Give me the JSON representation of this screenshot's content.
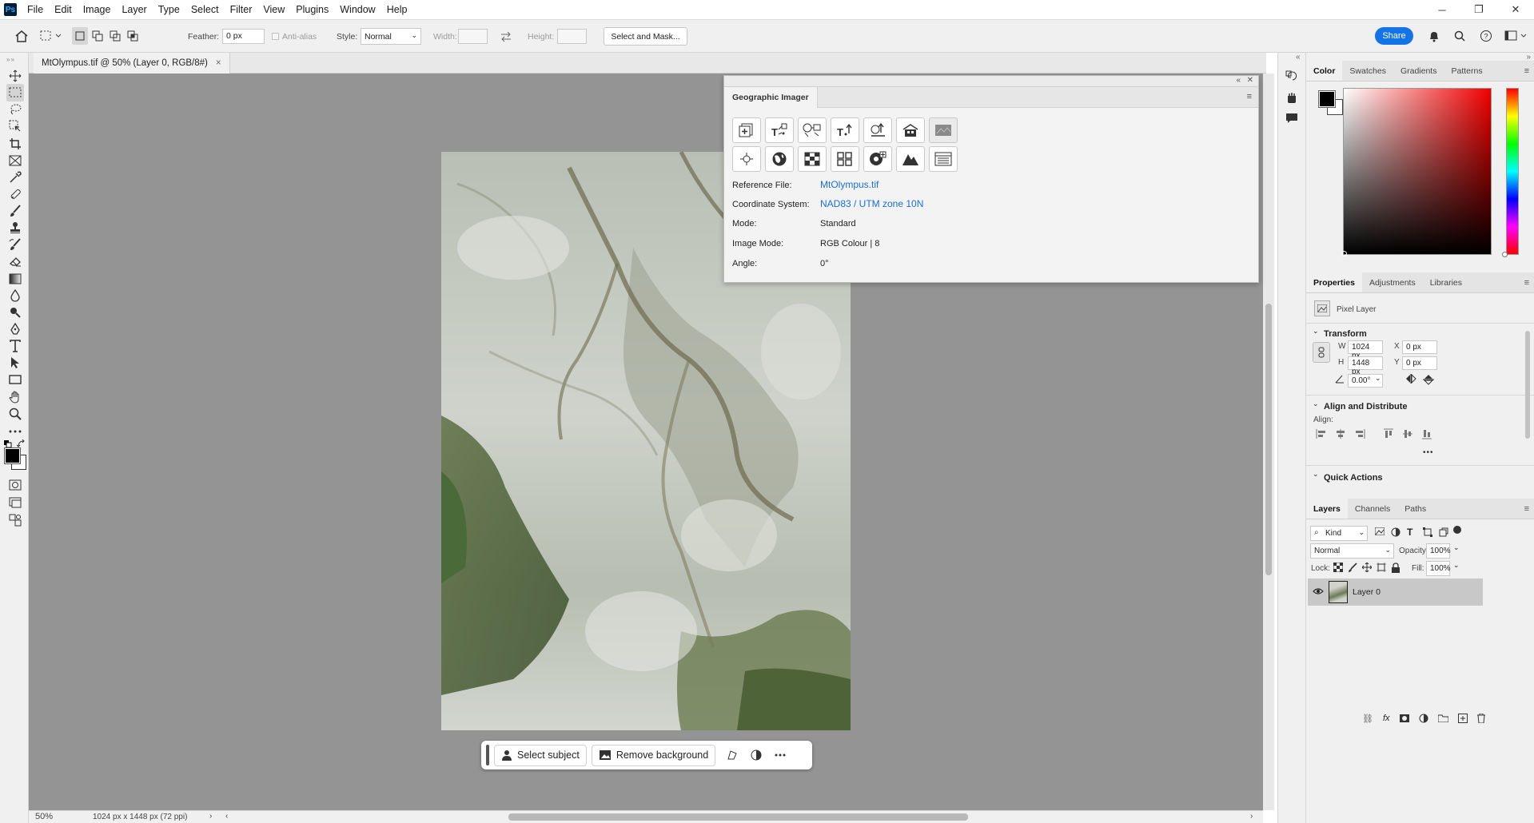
{
  "app": {
    "logo": "Ps"
  },
  "menu": [
    "File",
    "Edit",
    "Image",
    "Layer",
    "Type",
    "Select",
    "Filter",
    "View",
    "Plugins",
    "Window",
    "Help"
  ],
  "window_controls": {
    "minimize": "─",
    "restore": "❐",
    "close": "✕"
  },
  "options": {
    "feather_label": "Feather:",
    "feather_value": "0 px",
    "antialias_label": "Anti-alias",
    "style_label": "Style:",
    "style_value": "Normal",
    "width_label": "Width:",
    "height_label": "Height:",
    "select_mask": "Select and Mask...",
    "share": "Share"
  },
  "document": {
    "tab_title": "MtOlympus.tif @ 50% (Layer 0, RGB/8#)",
    "zoom": "50%",
    "info": "1024 px x 1448 px (72 ppi)"
  },
  "taskbar": {
    "select_subject": "Select subject",
    "remove_background": "Remove background"
  },
  "geo_panel": {
    "title": "Geographic Imager",
    "rows": [
      {
        "label": "Reference File:",
        "value": "MtOlympus.tif"
      },
      {
        "label": "Coordinate System:",
        "value": "NAD83 / UTM zone 10N"
      },
      {
        "label": "Mode:",
        "value": "Standard"
      },
      {
        "label": "Image Mode:",
        "value": "RGB Colour | 8"
      },
      {
        "label": "Angle:",
        "value": "0°"
      }
    ]
  },
  "color_panel": {
    "tabs": [
      "Color",
      "Swatches",
      "Gradients",
      "Patterns"
    ],
    "foreground": "#000000",
    "background": "#ffffff"
  },
  "properties_panel": {
    "tabs": [
      "Properties",
      "Adjustments",
      "Libraries"
    ],
    "layer_type": "Pixel Layer",
    "transform_title": "Transform",
    "w_label": "W",
    "w_value": "1024 px",
    "h_label": "H",
    "h_value": "1448 px",
    "x_label": "X",
    "x_value": "0 px",
    "y_label": "Y",
    "y_value": "0 px",
    "angle_value": "0.00°",
    "align_title": "Align and Distribute",
    "align_label": "Align:",
    "more": "•••",
    "quick_actions_title": "Quick Actions"
  },
  "layers_panel": {
    "tabs": [
      "Layers",
      "Channels",
      "Paths"
    ],
    "kind": "Kind",
    "blend_mode": "Normal",
    "opacity_label": "Opacity:",
    "opacity_value": "100%",
    "lock_label": "Lock:",
    "fill_label": "Fill:",
    "fill_value": "100%",
    "layers": [
      {
        "name": "Layer 0",
        "visible": true
      }
    ]
  },
  "colors": {
    "accent": "#1473e6",
    "link": "#1a6fd1",
    "canvas": "#949494"
  }
}
